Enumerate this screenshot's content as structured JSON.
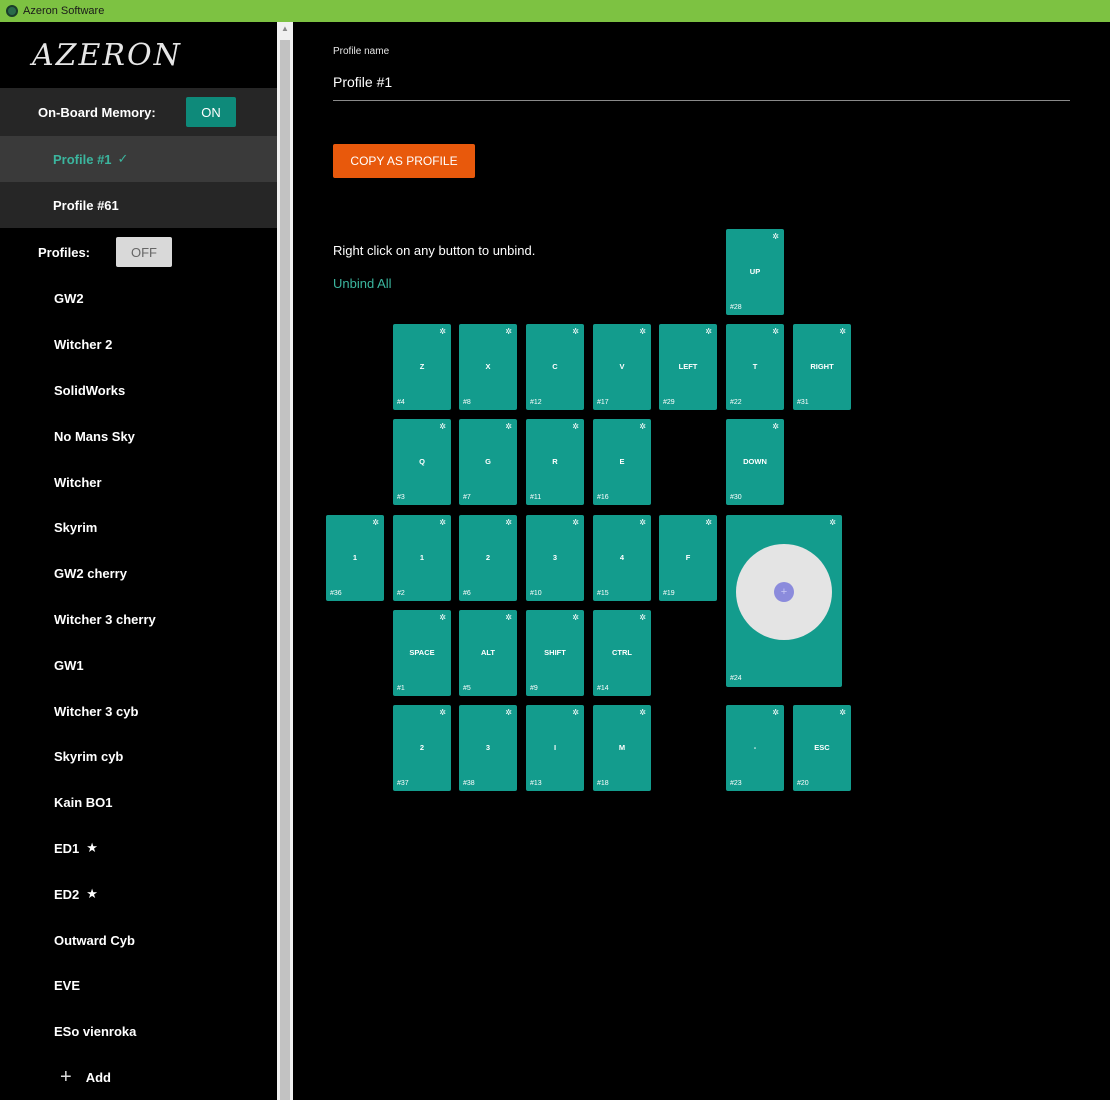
{
  "window": {
    "title": "Azeron Software"
  },
  "sidebar": {
    "logo": "AZERON",
    "onboard_label": "On-Board Memory:",
    "onboard_toggle": "ON",
    "memory_profiles": [
      {
        "label": "Profile #1",
        "check": "✓"
      },
      {
        "label": "Profile #61"
      }
    ],
    "profiles_label": "Profiles:",
    "profiles_toggle": "OFF",
    "profiles": [
      {
        "label": "GW2"
      },
      {
        "label": "Witcher 2"
      },
      {
        "label": "SolidWorks"
      },
      {
        "label": "No Mans Sky"
      },
      {
        "label": "Witcher"
      },
      {
        "label": "Skyrim"
      },
      {
        "label": "GW2 cherry"
      },
      {
        "label": "Witcher 3 cherry"
      },
      {
        "label": "GW1"
      },
      {
        "label": "Witcher 3 cyb"
      },
      {
        "label": "Skyrim cyb"
      },
      {
        "label": "Kain BO1"
      },
      {
        "label": "ED1",
        "star": "★"
      },
      {
        "label": "ED2",
        "star": "★"
      },
      {
        "label": "Outward Cyb"
      },
      {
        "label": "EVE"
      },
      {
        "label": "ESo vienroka"
      }
    ],
    "add_label": "Add"
  },
  "main": {
    "profile_name_label": "Profile name",
    "profile_name_value": "Profile #1",
    "copy_button": "COPY AS PROFILE",
    "hint": "Right click on any button to unbind.",
    "unbind_all": "Unbind All"
  },
  "keys": [
    {
      "label": "UP",
      "num": "#28"
    },
    {
      "label": "Z",
      "num": "#4"
    },
    {
      "label": "X",
      "num": "#8"
    },
    {
      "label": "C",
      "num": "#12"
    },
    {
      "label": "V",
      "num": "#17"
    },
    {
      "label": "LEFT",
      "num": "#29"
    },
    {
      "label": "T",
      "num": "#22"
    },
    {
      "label": "RIGHT",
      "num": "#31"
    },
    {
      "label": "Q",
      "num": "#3"
    },
    {
      "label": "G",
      "num": "#7"
    },
    {
      "label": "R",
      "num": "#11"
    },
    {
      "label": "E",
      "num": "#16"
    },
    {
      "label": "DOWN",
      "num": "#30"
    },
    {
      "label": "1",
      "num": "#36"
    },
    {
      "label": "1",
      "num": "#2"
    },
    {
      "label": "2",
      "num": "#6"
    },
    {
      "label": "3",
      "num": "#10"
    },
    {
      "label": "4",
      "num": "#15"
    },
    {
      "label": "F",
      "num": "#19"
    },
    {
      "label": "SPACE",
      "num": "#1"
    },
    {
      "label": "ALT",
      "num": "#5"
    },
    {
      "label": "SHIFT",
      "num": "#9"
    },
    {
      "label": "CTRL",
      "num": "#14"
    },
    {
      "label": "2",
      "num": "#37"
    },
    {
      "label": "3",
      "num": "#38"
    },
    {
      "label": "I",
      "num": "#13"
    },
    {
      "label": "M",
      "num": "#18"
    },
    {
      "label": "-",
      "num": "#23"
    },
    {
      "label": "ESC",
      "num": "#20"
    }
  ],
  "joystick": {
    "num": "#24",
    "center_glyph": "+"
  },
  "icons": {
    "gear": "gear-icon",
    "check": "check-icon",
    "star": "star-icon",
    "plus": "plus-icon"
  },
  "colors": {
    "accent": "#139c8d",
    "titlebar": "#7dc242",
    "copy_button": "#e8590c",
    "link": "#3bb59e"
  }
}
